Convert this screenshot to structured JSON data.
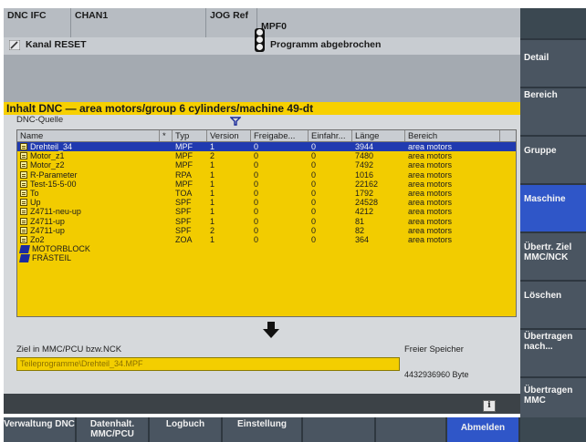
{
  "header": {
    "cells": [
      "DNC IFC",
      "CHAN1",
      "JOG Ref"
    ],
    "program": "MPF0",
    "channel_status": "Kanal RESET",
    "program_status": "Programm abgebrochen"
  },
  "main": {
    "title": "Inhalt DNC — area motors/group 6 cylinders/machine 49-dt",
    "source_label": "DNC-Quelle",
    "columns": [
      "Name",
      "*",
      "Typ",
      "Version",
      "Freigabe...",
      "Einfahr...",
      "Länge",
      "Bereich"
    ],
    "rows": [
      {
        "name": "Drehteil_34",
        "typ": "MPF",
        "version": "1",
        "frei": "0",
        "einf": "0",
        "len": "3944",
        "bereich": "area motors",
        "kind": "file",
        "selected": true
      },
      {
        "name": "Motor_z1",
        "typ": "MPF",
        "version": "2",
        "frei": "0",
        "einf": "0",
        "len": "7480",
        "bereich": "area motors",
        "kind": "file"
      },
      {
        "name": "Motor_z2",
        "typ": "MPF",
        "version": "1",
        "frei": "0",
        "einf": "0",
        "len": "7492",
        "bereich": "area motors",
        "kind": "file"
      },
      {
        "name": "R-Parameter",
        "typ": "RPA",
        "version": "1",
        "frei": "0",
        "einf": "0",
        "len": "1016",
        "bereich": "area motors",
        "kind": "file"
      },
      {
        "name": "Test-15-5-00",
        "typ": "MPF",
        "version": "1",
        "frei": "0",
        "einf": "0",
        "len": "22162",
        "bereich": "area motors",
        "kind": "file"
      },
      {
        "name": "To",
        "typ": "TOA",
        "version": "1",
        "frei": "0",
        "einf": "0",
        "len": "1792",
        "bereich": "area motors",
        "kind": "file"
      },
      {
        "name": "Up",
        "typ": "SPF",
        "version": "1",
        "frei": "0",
        "einf": "0",
        "len": "24528",
        "bereich": "area motors",
        "kind": "file"
      },
      {
        "name": "Z4711-neu-up",
        "typ": "SPF",
        "version": "1",
        "frei": "0",
        "einf": "0",
        "len": "4212",
        "bereich": "area motors",
        "kind": "file"
      },
      {
        "name": "Z4711-up",
        "typ": "SPF",
        "version": "1",
        "frei": "0",
        "einf": "0",
        "len": "81",
        "bereich": "area motors",
        "kind": "file"
      },
      {
        "name": "Z4711-up",
        "typ": "SPF",
        "version": "2",
        "frei": "0",
        "einf": "0",
        "len": "82",
        "bereich": "area motors",
        "kind": "file"
      },
      {
        "name": "Zo2",
        "typ": "ZOA",
        "version": "1",
        "frei": "0",
        "einf": "0",
        "len": "364",
        "bereich": "area motors",
        "kind": "file"
      },
      {
        "name": "MOTORBLOCK",
        "typ": "",
        "version": "",
        "frei": "",
        "einf": "",
        "len": "",
        "bereich": "",
        "kind": "dir"
      },
      {
        "name": "FRÄSTEIL",
        "typ": "",
        "version": "",
        "frei": "",
        "einf": "",
        "len": "",
        "bereich": "",
        "kind": "dir"
      }
    ],
    "target_label": "Ziel in MMC/PCU bzw.NCK",
    "target_value": "Teileprogramme\\Drehteil_34.MPF",
    "free_label": "Freier Speicher",
    "free_value": "4432936960 Byte"
  },
  "softkeys_right": [
    {
      "label": "Detail"
    },
    {
      "label": "Bereich"
    },
    {
      "label": "Gruppe"
    },
    {
      "label": "Maschine",
      "active": true
    },
    {
      "label": "Übertr. Ziel MMC/NCK"
    },
    {
      "label": "Löschen"
    },
    {
      "label": "Übertragen nach..."
    },
    {
      "label": "Übertragen MMC"
    }
  ],
  "softkeys_bottom": [
    {
      "label": "Verwaltung DNC"
    },
    {
      "label": "Datenhalt. MMC/PCU"
    },
    {
      "label": "Logbuch"
    },
    {
      "label": "Einstellung"
    },
    {
      "label": ""
    },
    {
      "label": ""
    },
    {
      "label": "Abmelden",
      "active": true
    }
  ],
  "icons": {
    "filter": "filter-icon",
    "file": "file-icon",
    "directory": "folder-icon",
    "info": "info-icon",
    "arrow": "down-arrow-icon",
    "traffic_light": "status-light-icon",
    "pencil": "pencil-icon"
  },
  "colors": {
    "accent_yellow": "#f2cc00",
    "selection_blue": "#203ab0",
    "softkey": "#4a5561",
    "active_softkey": "#2f56c8"
  }
}
